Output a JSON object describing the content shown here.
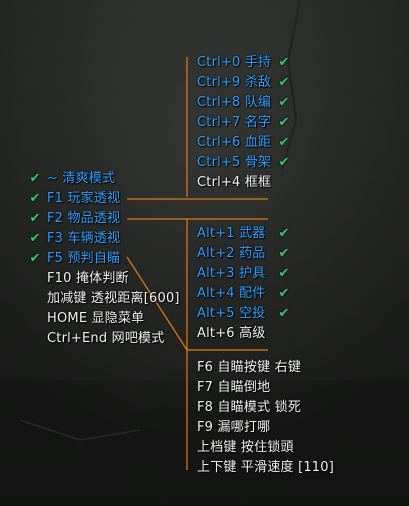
{
  "theme": {
    "active_color": "#2f9fff",
    "inactive_color": "#f2f2f2",
    "check_color": "#35c96a",
    "line_color": "#e07a10",
    "check_icon": "check-icon"
  },
  "right_top_menu": [
    {
      "label": "Ctrl+0 手持",
      "active": true
    },
    {
      "label": "Ctrl+9 杀敌",
      "active": true
    },
    {
      "label": "Ctrl+8 队编",
      "active": true
    },
    {
      "label": "Ctrl+7 名字",
      "active": true
    },
    {
      "label": "Ctrl+6 血距",
      "active": true
    },
    {
      "label": "Ctrl+5 骨架",
      "active": true
    },
    {
      "label": "Ctrl+4 框框",
      "active": false
    }
  ],
  "left_menu": [
    {
      "label": "~  清爽模式",
      "active": true
    },
    {
      "label": "F1 玩家透视",
      "active": true
    },
    {
      "label": "F2 物品透视",
      "active": true
    },
    {
      "label": "F3 车辆透视",
      "active": true
    },
    {
      "label": "F5 预判自瞄",
      "active": true
    },
    {
      "label": "F10 掩体判断",
      "active": false
    },
    {
      "label": "加减键 透视距离[600]",
      "active": false
    },
    {
      "label": "HOME 显隐菜单",
      "active": false
    },
    {
      "label": "Ctrl+End 网吧模式",
      "active": false
    }
  ],
  "right_mid_menu": [
    {
      "label": "Alt+1  武器",
      "active": true
    },
    {
      "label": "Alt+2  药品",
      "active": true
    },
    {
      "label": "Alt+3  护具",
      "active": true
    },
    {
      "label": "Alt+4  配件",
      "active": true
    },
    {
      "label": "Alt+5  空投",
      "active": true
    },
    {
      "label": "Alt+6  高级",
      "active": false
    }
  ],
  "right_bottom_menu": [
    {
      "label": "F6 自瞄按键 右键",
      "active": false
    },
    {
      "label": "F7 自瞄倒地",
      "active": false
    },
    {
      "label": "F8 自瞄模式 锁死",
      "active": false
    },
    {
      "label": "F9 漏哪打哪",
      "active": false
    },
    {
      "label": "上档键 按住锁頭",
      "active": false
    },
    {
      "label": "上下键 平滑速度 [110]",
      "active": false
    }
  ]
}
